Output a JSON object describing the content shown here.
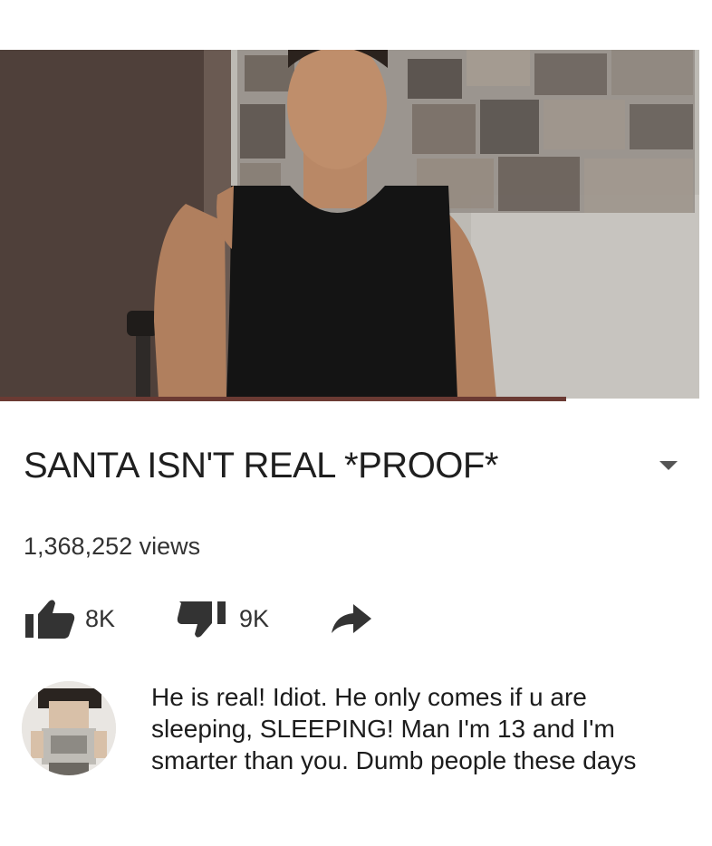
{
  "video": {
    "title": "SANTA ISN'T REAL *PROOF*",
    "views": "1,368,252 views",
    "progress_fraction": 0.81
  },
  "actions": {
    "likes": "8K",
    "dislikes": "9K"
  },
  "comment": {
    "text": "He is real! Idiot. He only comes if u are sleeping, SLEEPING! Man I'm 13 and I'm smarter than you. Dumb people these days"
  },
  "icons": {
    "like": "thumbs-up-icon",
    "dislike": "thumbs-down-icon",
    "share": "share-arrow-icon",
    "expand": "chevron-down-icon"
  },
  "colors": {
    "progress": "#6b3a33",
    "icon": "#333333"
  }
}
